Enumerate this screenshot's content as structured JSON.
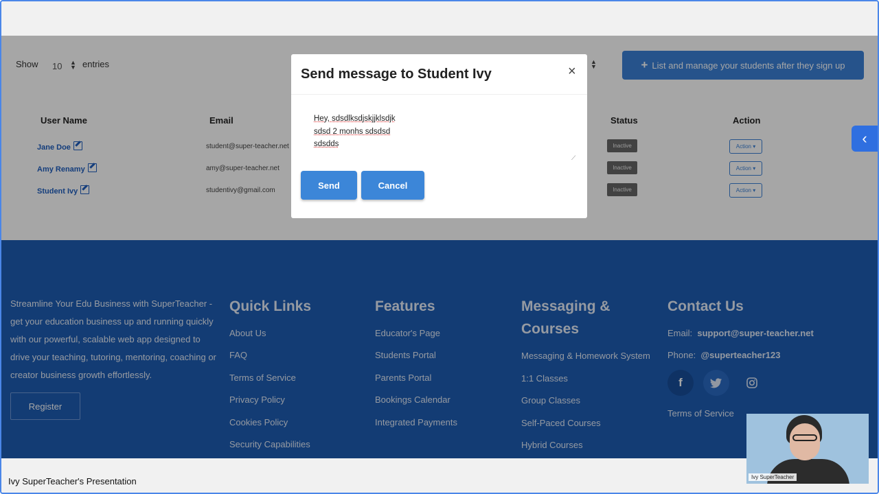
{
  "presentation": {
    "title": "Ivy SuperTeacher's Presentation",
    "camera_label": "Ivy SuperTeacher"
  },
  "toolbar": {
    "show_label": "Show",
    "entries_value": "10",
    "entries_label": "entries",
    "list_button_label": "List and manage your students after they sign up"
  },
  "table": {
    "headers": {
      "user_name": "User Name",
      "email": "Email",
      "status": "Status",
      "action": "Action"
    },
    "rows": [
      {
        "name": "Jane Doe",
        "email": "student@super-teacher.net",
        "status": "Inactive",
        "action": "Action"
      },
      {
        "name": "Amy Renamy",
        "email": "amy@super-teacher.net",
        "status": "Inactive",
        "action": "Action"
      },
      {
        "name": "Student Ivy",
        "email": "studentivy@gmail.com",
        "status": "Inactive",
        "action": "Action"
      }
    ]
  },
  "modal": {
    "title": "Send message to Student Ivy",
    "close_symbol": "×",
    "message_lines": [
      "Hey, sdsdlksdjskjjklsdjk",
      "sdsd 2 monhs sdsdsd",
      "sdsdds"
    ],
    "send_label": "Send",
    "cancel_label": "Cancel"
  },
  "footer": {
    "description": "Streamline Your Edu Business with SuperTeacher - get your education business up and running quickly with our powerful, scalable web app designed to drive your teaching, tutoring, mentoring, coaching or creator business growth effortlessly.",
    "register_label": "Register",
    "quick_links": {
      "title": "Quick Links",
      "items": [
        "About Us",
        "FAQ",
        "Terms of Service",
        "Privacy Policy",
        "Cookies Policy",
        "Security Capabilities"
      ]
    },
    "features": {
      "title": "Features",
      "items": [
        "Educator's Page",
        "Students Portal",
        "Parents Portal",
        "Bookings Calendar",
        "Integrated Payments"
      ]
    },
    "messaging": {
      "title": "Messaging & Courses",
      "items": [
        "Messaging & Homework System",
        "1:1 Classes",
        "Group Classes",
        "Self-Paced Courses",
        "Hybrid Courses"
      ]
    },
    "contact": {
      "title": "Contact Us",
      "email_label": "Email:",
      "email_value": "support@super-teacher.net",
      "phone_label": "Phone:",
      "phone_value": "@superteacher123",
      "terms": "Terms of Service",
      "social": [
        "facebook-icon",
        "twitter-icon",
        "instagram-icon"
      ]
    }
  },
  "colors": {
    "primary": "#3c86d8",
    "footer": "#1e5cb3",
    "status_inactive": "#666666",
    "side_tab": "#2f6fe0"
  }
}
